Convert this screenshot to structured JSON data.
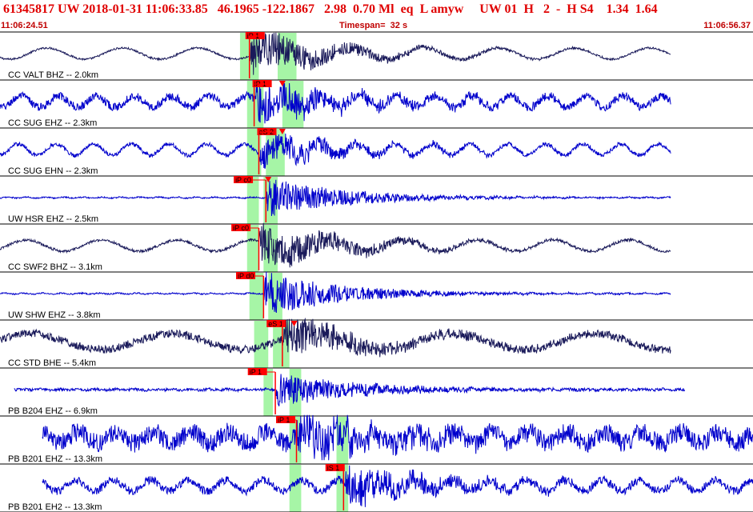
{
  "header": {
    "event_line": "61345817 UW 2018-01-31 11:06:33.85   46.1965 -122.1867   2.98  0.70 Ml  eq  L amyw     UW 01  H   2  -  H S4    1.34  1.64",
    "start_time": "11:06:24.51",
    "timespan": "Timespan=  32 s",
    "end_time": "11:06:56.37"
  },
  "colors": {
    "header_text": "#e00000",
    "pick": "#ff0000",
    "window": "#a6f5a6",
    "trace_blue": "#0000cc",
    "trace_dark": "#1a1a5a",
    "divider": "#000000"
  },
  "chart_data": {
    "type": "seismogram",
    "time_start": "11:06:24.51",
    "time_end": "11:06:56.37",
    "timespan_s": 32,
    "traces": [
      {
        "label": "CC VALT BHZ -- 2.0km",
        "color": "dark",
        "picks": [
          {
            "label": "iP 1",
            "t": 10.5
          }
        ],
        "windows": [
          [
            10.2,
            11.0
          ],
          [
            11.8,
            12.6
          ]
        ],
        "onset": 10.6,
        "amp": 1.0,
        "noise": 0.07,
        "ls": "long",
        "start": 0.0,
        "end": 28.5,
        "triangles": []
      },
      {
        "label": "CC SUG EHZ -- 2.3km",
        "color": "blue",
        "picks": [
          {
            "label": "iP 1",
            "t": 10.8
          }
        ],
        "windows": [
          [
            10.5,
            11.2
          ],
          [
            12.0,
            12.9
          ]
        ],
        "onset": 10.8,
        "amp": 0.9,
        "noise": 0.3,
        "ls": "mid",
        "start": 0.0,
        "end": 28.5,
        "triangles": [
          12.0
        ]
      },
      {
        "label": "CC SUG EHN -- 2.3km",
        "color": "blue",
        "picks": [
          {
            "label": "eS 2",
            "t": 11.0
          }
        ],
        "windows": [
          [
            10.5,
            11.1
          ],
          [
            11.3,
            12.1
          ]
        ],
        "onset": 11.0,
        "amp": 0.75,
        "noise": 0.15,
        "ls": "mid",
        "start": 0.0,
        "end": 28.5,
        "triangles": [
          12.0
        ]
      },
      {
        "label": "UW HSR EHZ -- 2.5km",
        "color": "blue",
        "picks": [
          {
            "label": "iP c0",
            "t": 10.0
          }
        ],
        "windows": [
          [
            10.5,
            11.0
          ],
          [
            11.2,
            11.8
          ]
        ],
        "onset": 11.3,
        "amp": 0.9,
        "noise": 0.05,
        "ls": "short",
        "start": 0.0,
        "end": 28.5,
        "triangles": [
          11.4
        ]
      },
      {
        "label": "CC SWF2 BHZ -- 3.1km",
        "color": "dark",
        "picks": [
          {
            "label": "iP c0",
            "t": 9.9
          }
        ],
        "windows": [
          [
            10.5,
            11.0
          ],
          [
            11.2,
            11.8
          ]
        ],
        "onset": 11.0,
        "amp": 1.0,
        "noise": 0.1,
        "ls": "long",
        "start": 0.0,
        "end": 28.5,
        "triangles": []
      },
      {
        "label": "UW SHW EHZ -- 3.8km",
        "color": "blue",
        "picks": [
          {
            "label": "iP d0",
            "t": 10.1
          }
        ],
        "windows": [
          [
            10.6,
            11.2
          ],
          [
            11.4,
            12.0
          ]
        ],
        "onset": 11.2,
        "amp": 1.0,
        "noise": 0.05,
        "ls": "short",
        "start": 0.0,
        "end": 28.5,
        "triangles": []
      },
      {
        "label": "CC STD BHE -- 5.4km",
        "color": "dark",
        "picks": [
          {
            "label": "eS 1",
            "t": 11.4
          }
        ],
        "windows": [
          [
            10.8,
            11.4
          ],
          [
            11.6,
            12.3
          ]
        ],
        "onset": 12.0,
        "amp": 0.9,
        "noise": 0.3,
        "ls": "vlong",
        "start": 0.0,
        "end": 28.5,
        "triangles": [
          12.5
        ]
      },
      {
        "label": "PB B204 EHZ -- 6.9km",
        "color": "blue",
        "picks": [
          {
            "label": "iP 1",
            "t": 10.6
          }
        ],
        "windows": [
          [
            11.2,
            11.6
          ],
          [
            12.3,
            12.8
          ]
        ],
        "onset": 11.7,
        "amp": 0.8,
        "noise": 0.1,
        "ls": "short",
        "start": 0.6,
        "end": 29.1,
        "triangles": []
      },
      {
        "label": "PB B201 EHZ -- 13.3km",
        "color": "blue",
        "picks": [
          {
            "label": "iP 1",
            "t": 11.8
          }
        ],
        "windows": [
          [
            12.3,
            12.8
          ],
          [
            14.3,
            14.8
          ]
        ],
        "onset": 12.6,
        "amp": 1.2,
        "noise": 0.7,
        "ls": "mid",
        "start": 1.8,
        "end": 32.0,
        "triangles": []
      },
      {
        "label": "PB B201 EH2 -- 13.3km",
        "color": "blue",
        "picks": [
          {
            "label": "iS 1",
            "t": 13.9
          }
        ],
        "windows": [
          [
            12.3,
            12.8
          ],
          [
            14.3,
            14.8
          ]
        ],
        "onset": 14.6,
        "amp": 1.0,
        "noise": 0.3,
        "ls": "mid",
        "start": 1.8,
        "end": 32.0,
        "triangles": []
      }
    ]
  }
}
